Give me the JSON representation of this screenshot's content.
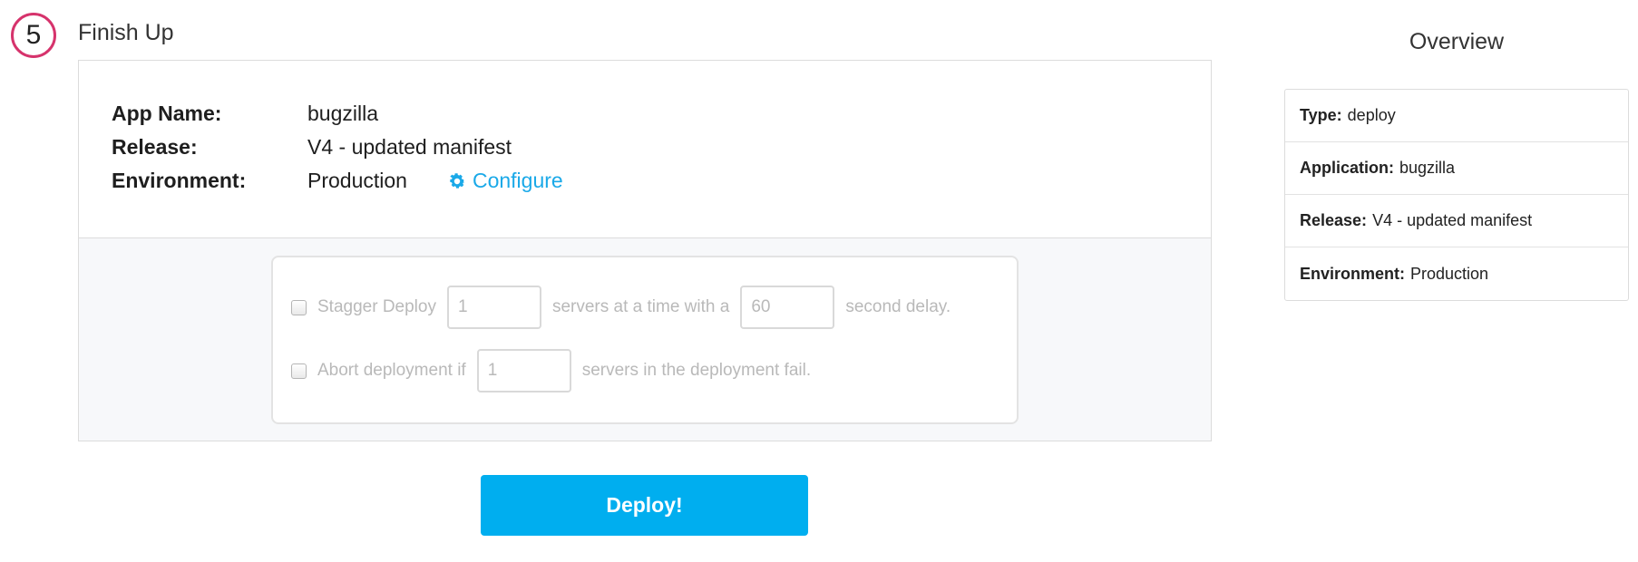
{
  "step": {
    "number": "5",
    "title": "Finish Up"
  },
  "details": {
    "app_name_label": "App Name:",
    "app_name_value": "bugzilla",
    "release_label": "Release:",
    "release_value": "V4 - updated manifest",
    "environment_label": "Environment:",
    "environment_value": "Production",
    "configure_label": "Configure",
    "configure_icon": "gear-icon"
  },
  "options": {
    "stagger_label": "Stagger Deploy",
    "stagger_servers_value": "1",
    "stagger_mid_text": "servers at a time with a",
    "stagger_delay_value": "60",
    "stagger_end_text": "second delay.",
    "abort_label": "Abort deployment if",
    "abort_servers_value": "1",
    "abort_end_text": "servers in the deployment fail."
  },
  "deploy_button_label": "Deploy!",
  "overview": {
    "title": "Overview",
    "items": [
      {
        "label": "Type:",
        "value": "deploy"
      },
      {
        "label": "Application:",
        "value": "bugzilla"
      },
      {
        "label": "Release:",
        "value": "V4 - updated manifest"
      },
      {
        "label": "Environment:",
        "value": "Production"
      }
    ]
  },
  "colors": {
    "step_circle": "#d6336c",
    "link": "#1aa9e8",
    "deploy_button": "#00aeef"
  }
}
